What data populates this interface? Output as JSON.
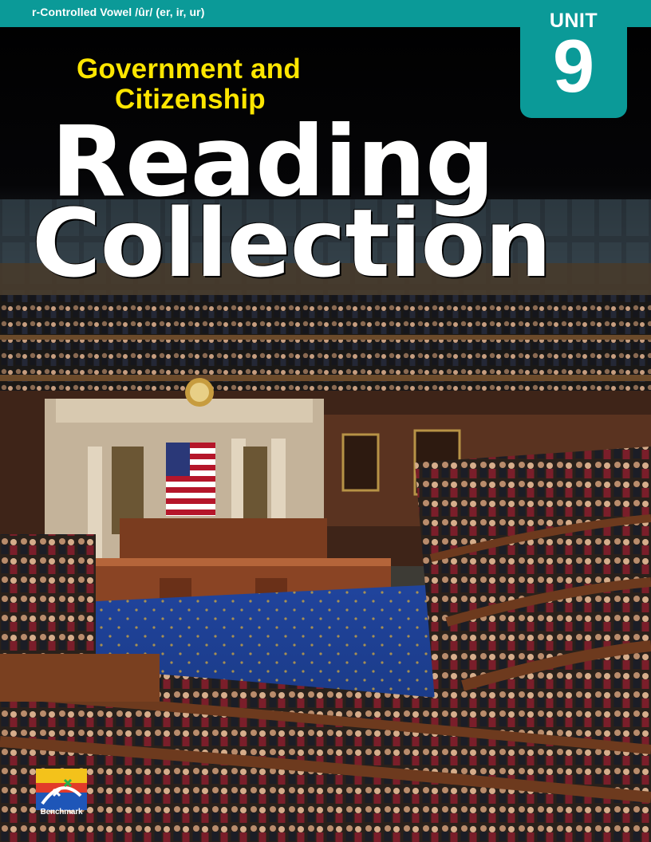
{
  "header": {
    "skill": "r-Controlled Vowel /ûr/ (er, ir, ur)"
  },
  "unit": {
    "label": "UNIT",
    "number": "9"
  },
  "subject": {
    "line1": "Government and",
    "line2": "Citizenship"
  },
  "title": {
    "line1": "Reading",
    "line2": "Collection"
  },
  "publisher": {
    "logo_text": "Benchmark"
  },
  "colors": {
    "teal": "#0b9a98",
    "yellow": "#fde600",
    "white": "#ffffff",
    "carpet_blue": "#1d3f9a"
  },
  "icons": [
    "benchmark-logo-icon",
    "american-flag-icon",
    "clock-icon"
  ]
}
